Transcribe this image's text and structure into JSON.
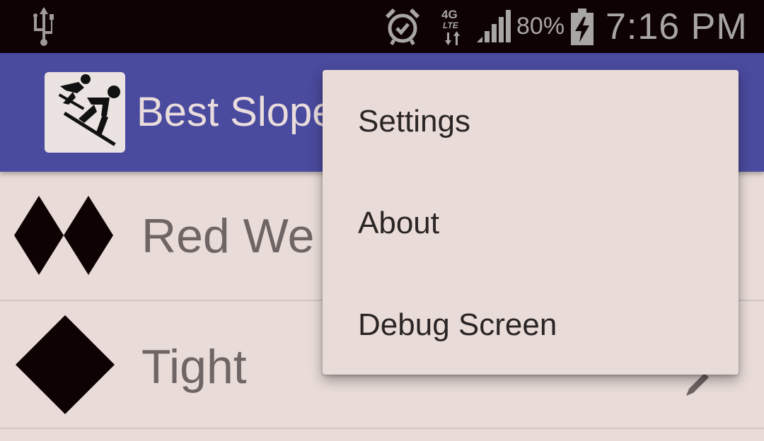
{
  "status_bar": {
    "icons": [
      "usb-icon",
      "alarm-icon",
      "network-4g-lte-icon",
      "signal-icon",
      "battery-charging-icon"
    ],
    "network_label_top": "4G",
    "network_label_bottom": "LTE",
    "battery_percent": "80%",
    "time": "7:16 PM"
  },
  "action_bar": {
    "title": "Best Slopes",
    "color": "#4a4a9e"
  },
  "list": {
    "items": [
      {
        "label": "Red We",
        "icon": "double-black-diamond-icon"
      },
      {
        "label": "Tight",
        "icon": "black-diamond-icon"
      }
    ]
  },
  "menu": {
    "items": [
      {
        "label": "Settings"
      },
      {
        "label": "About"
      },
      {
        "label": "Debug Screen"
      }
    ]
  }
}
